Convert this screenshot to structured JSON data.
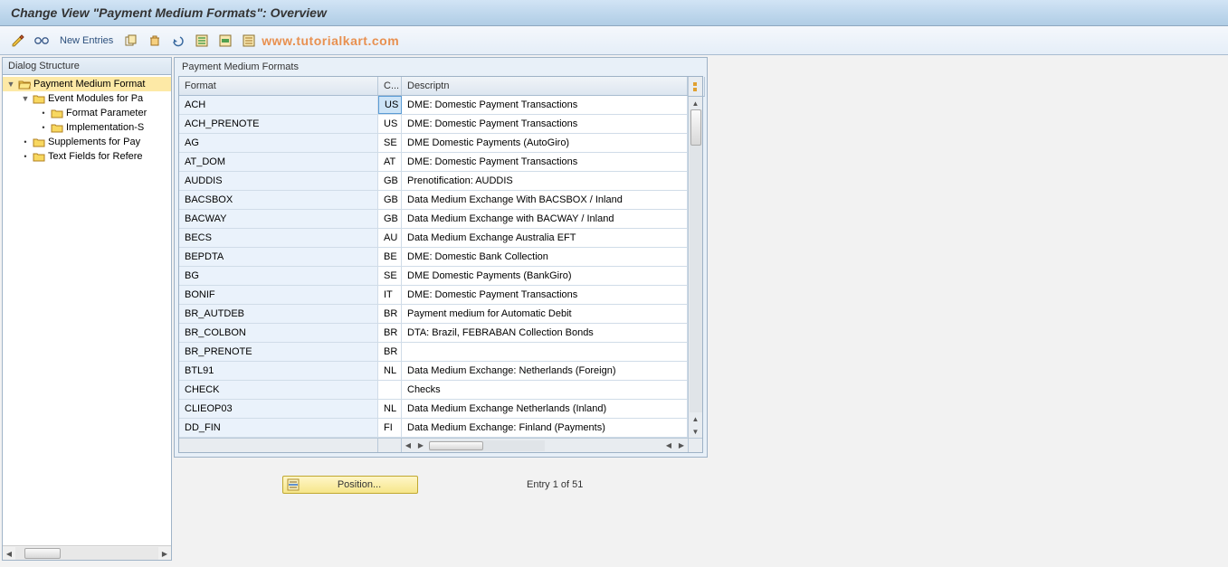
{
  "title": "Change View \"Payment Medium Formats\": Overview",
  "toolbar": {
    "new_entries": "New Entries"
  },
  "watermark": "www.tutorialkart.com",
  "dialog_structure": {
    "header": "Dialog Structure",
    "nodes": [
      {
        "label": "Payment Medium Format",
        "indent": 0,
        "icon": "folder-open",
        "selected": true,
        "arrow": "down"
      },
      {
        "label": "Event Modules for Pa",
        "indent": 1,
        "icon": "folder",
        "arrow": "down"
      },
      {
        "label": "Format Parameter",
        "indent": 2,
        "icon": "folder",
        "arrow": "dot"
      },
      {
        "label": "Implementation-S",
        "indent": 2,
        "icon": "folder",
        "arrow": "dot"
      },
      {
        "label": "Supplements for Pay",
        "indent": 1,
        "icon": "folder",
        "arrow": "dot"
      },
      {
        "label": "Text Fields for Refere",
        "indent": 1,
        "icon": "folder",
        "arrow": "dot"
      }
    ]
  },
  "panel": {
    "title": "Payment Medium Formats",
    "columns": {
      "format": "Format",
      "c": "C...",
      "desc": "Descriptn"
    },
    "rows": [
      {
        "format": "ACH",
        "c": "US",
        "desc": "DME: Domestic Payment Transactions",
        "sel": true
      },
      {
        "format": "ACH_PRENOTE",
        "c": "US",
        "desc": "DME: Domestic Payment Transactions"
      },
      {
        "format": "AG",
        "c": "SE",
        "desc": "DME Domestic Payments (AutoGiro)"
      },
      {
        "format": "AT_DOM",
        "c": "AT",
        "desc": "DME: Domestic Payment Transactions"
      },
      {
        "format": "AUDDIS",
        "c": "GB",
        "desc": "Prenotification: AUDDIS"
      },
      {
        "format": "BACSBOX",
        "c": "GB",
        "desc": "Data Medium Exchange With BACSBOX / Inland"
      },
      {
        "format": "BACWAY",
        "c": "GB",
        "desc": "Data Medium Exchange with BACWAY / Inland"
      },
      {
        "format": "BECS",
        "c": "AU",
        "desc": "Data Medium Exchange Australia EFT"
      },
      {
        "format": "BEPDTA",
        "c": "BE",
        "desc": "DME: Domestic Bank Collection"
      },
      {
        "format": "BG",
        "c": "SE",
        "desc": "DME Domestic Payments (BankGiro)"
      },
      {
        "format": "BONIF",
        "c": "IT",
        "desc": "DME: Domestic Payment Transactions"
      },
      {
        "format": "BR_AUTDEB",
        "c": "BR",
        "desc": "Payment medium for Automatic Debit"
      },
      {
        "format": "BR_COLBON",
        "c": "BR",
        "desc": "DTA: Brazil, FEBRABAN Collection Bonds"
      },
      {
        "format": "BR_PRENOTE",
        "c": "BR",
        "desc": ""
      },
      {
        "format": "BTL91",
        "c": "NL",
        "desc": "Data Medium Exchange: Netherlands (Foreign)"
      },
      {
        "format": "CHECK",
        "c": "",
        "desc": "Checks"
      },
      {
        "format": "CLIEOP03",
        "c": "NL",
        "desc": "Data Medium Exchange Netherlands (Inland)"
      },
      {
        "format": "DD_FIN",
        "c": "FI",
        "desc": "Data Medium Exchange: Finland (Payments)"
      }
    ]
  },
  "footer": {
    "position_label": "Position...",
    "entry_info": "Entry 1 of 51"
  }
}
